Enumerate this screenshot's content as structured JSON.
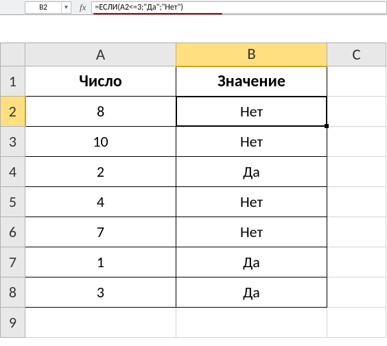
{
  "formula_bar": {
    "cell_ref": "B2",
    "fx_label": "fx",
    "formula": "=ЕСЛИ(A2<=3;\"Да\";\"Нет\")"
  },
  "columns": [
    "A",
    "B",
    "C"
  ],
  "row_numbers": [
    "1",
    "2",
    "3",
    "4",
    "5",
    "6",
    "7",
    "8",
    "9"
  ],
  "headers": {
    "A": "Число",
    "B": "Значение"
  },
  "rows": [
    {
      "A": "8",
      "B": "Нет"
    },
    {
      "A": "10",
      "B": "Нет"
    },
    {
      "A": "2",
      "B": "Да"
    },
    {
      "A": "4",
      "B": "Нет"
    },
    {
      "A": "7",
      "B": "Нет"
    },
    {
      "A": "1",
      "B": "Да"
    },
    {
      "A": "3",
      "B": "Да"
    }
  ],
  "active_cell": "B2",
  "selected_col": "B",
  "selected_row": "2"
}
